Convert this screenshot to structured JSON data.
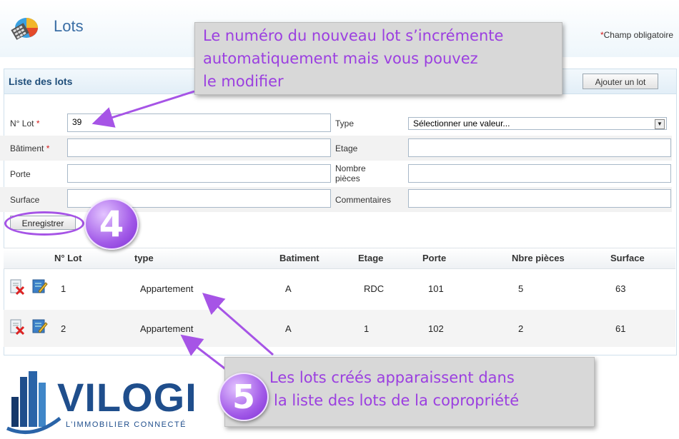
{
  "page": {
    "title": "Lots"
  },
  "panel": {
    "title": "Liste des lots",
    "add_button": "Ajouter un lot",
    "required_star": "*",
    "required_note": "Champ obligatoire"
  },
  "form": {
    "lot_number": {
      "label": "N° Lot",
      "required": "*",
      "value": "39"
    },
    "type": {
      "label": "Type",
      "selected": "Sélectionner une valeur...",
      "arrow": "▼"
    },
    "building": {
      "label": "Bâtiment",
      "required": "*",
      "value": ""
    },
    "floor": {
      "label": "Etage",
      "value": ""
    },
    "door": {
      "label": "Porte",
      "value": ""
    },
    "rooms": {
      "label_line1": "Nombre",
      "label_line2": "pièces",
      "value": ""
    },
    "area": {
      "label": "Surface",
      "value": ""
    },
    "comments": {
      "label": "Commentaires",
      "value": ""
    },
    "save_button": "Enregistrer"
  },
  "table": {
    "headers": [
      "N° Lot",
      "type",
      "Batiment",
      "Etage",
      "Porte",
      "Nbre pièces",
      "Surface"
    ],
    "rows": [
      {
        "lot": "1",
        "type": "Appartement",
        "building": "A",
        "floor": "RDC",
        "door": "101",
        "rooms": "5",
        "area": "63"
      },
      {
        "lot": "2",
        "type": "Appartement",
        "building": "A",
        "floor": "1",
        "door": "102",
        "rooms": "2",
        "area": "61"
      }
    ]
  },
  "annotations": {
    "callout_top": {
      "line1": "Le numéro du nouveau lot s’incrémente",
      "line2": "automatiquement mais vous pouvez",
      "line3": "le modifier"
    },
    "callout_bottom": {
      "line1": "Les lots créés apparaissent dans",
      "line2": "la liste des lots de la copropriété"
    },
    "step4": "4",
    "step5": "5",
    "accent_color": "#9b3fe0"
  },
  "brand": {
    "name": "VILOGI",
    "tagline": "L’IMMOBILIER CONNECTÉ"
  }
}
